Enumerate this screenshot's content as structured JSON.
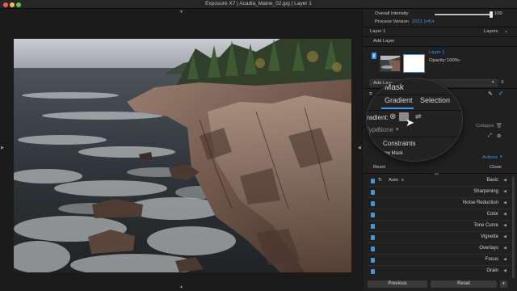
{
  "window": {
    "title": "Exposure X7 | Acadia_Maine_02.jpg | Layer 1"
  },
  "panel": {
    "overall_intensity_label": "Overall Intensity",
    "overall_intensity_value": "100",
    "overall_intensity_level": 1.0,
    "process_version_label": "Process Version",
    "process_version_value": "2021 (v4)",
    "layers_section": "Layer 1",
    "layers_menu": "Layers",
    "add_layer": "Add Layer",
    "layer_name": "Layer 1",
    "opacity_label": "Opacity:",
    "opacity_value": "100%",
    "add_layer_with": "Add Layer with...",
    "mask_title": "Mask",
    "tabs": [
      "Gradient",
      "Selection"
    ],
    "gradient_label": "Gradient:",
    "type_label": "Type:",
    "type_value": "None",
    "collapse": "Collapse",
    "constraints": "Constraints",
    "show_mask": "Show Mask",
    "actions": "Actions",
    "reset": "Reset",
    "close": "Close"
  },
  "adjustments": {
    "auto": "Auto",
    "items": [
      "Basic",
      "Sharpening",
      "Noise Reduction",
      "Color",
      "Tone Curve",
      "Vignette",
      "Overlays",
      "Focus",
      "Grain"
    ]
  },
  "footer": {
    "previous": "Previous",
    "reset": "Reset"
  },
  "colors": {
    "accent": "#3d98e6",
    "panel_bg": "#202020",
    "canvas_bg": "#1b1b1b"
  }
}
